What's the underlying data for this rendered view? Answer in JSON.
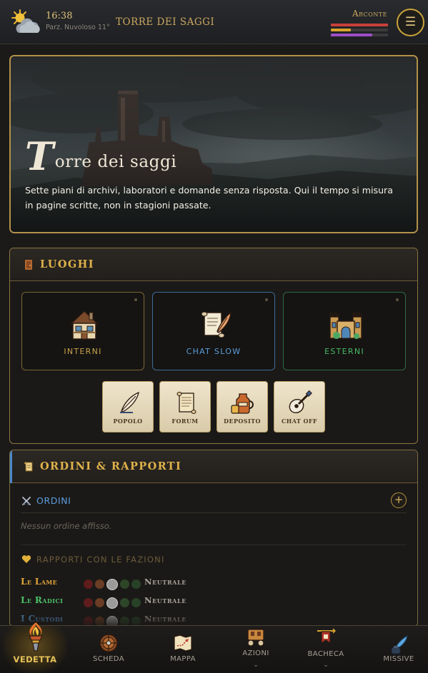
{
  "topbar": {
    "time": "16:38",
    "weather": "Parz. Nuvoloso 11°",
    "weather_icon": "sun-cloud-icon",
    "location": "TORRE DEI SAGGI",
    "role": "Arconte",
    "stats": [
      {
        "name": "health",
        "color": "#c8403a",
        "fraction": 1.0
      },
      {
        "name": "energy",
        "color": "#d9a32a",
        "fraction": 0.35
      },
      {
        "name": "mana",
        "color": "#9d4ec7",
        "fraction": 0.72
      }
    ],
    "menu_glyph": "☰"
  },
  "hero": {
    "initial": "T",
    "title_rest": "orre dei saggi",
    "description": "Sette piani di archivi, laboratori e domande senza risposta. Qui il tempo si misura in pagine scritte, non in stagioni passate."
  },
  "luoghi": {
    "title": "LUOGHI",
    "cards": [
      {
        "label": "INTERNI",
        "icon": "house-icon",
        "color": "#c9a24b"
      },
      {
        "label": "CHAT SLOW",
        "icon": "scroll-quill-icon",
        "color": "#5b9ddd"
      },
      {
        "label": "ESTERNI",
        "icon": "castle-icon",
        "color": "#49b96a"
      }
    ],
    "tiles": [
      {
        "label": "POPOLO",
        "icon": "quill-icon"
      },
      {
        "label": "FORUM",
        "icon": "parchment-icon"
      },
      {
        "label": "DEPOSITO",
        "icon": "jug-icon"
      },
      {
        "label": "CHAT OFF",
        "icon": "lute-icon"
      }
    ]
  },
  "ordini": {
    "title": "ORDINI & RAPPORTI",
    "orders_label": "ORDINI",
    "add_glyph": "+",
    "empty_note": "Nessun ordine affisso.",
    "relations_label": "RAPPORTI CON LE FAZIONI",
    "factions": [
      {
        "name": "Le Lame",
        "color": "#e0a63a",
        "status": "Neutrale"
      },
      {
        "name": "Le Radici",
        "color": "#4cc06a",
        "status": "Neutrale"
      },
      {
        "name": "I Custodi",
        "color": "#5b9ddd",
        "status": "Neutrale"
      }
    ],
    "relation_colors": [
      "#5e1c1c",
      "#6a3d24",
      "sel",
      "#2e4628",
      "#274227"
    ]
  },
  "nav": [
    {
      "label": "VEDETTA",
      "icon": "torch-icon",
      "active": true
    },
    {
      "label": "SCHEDA",
      "icon": "shield-icon"
    },
    {
      "label": "MAPPA",
      "icon": "map-icon"
    },
    {
      "label": "AZIONI",
      "icon": "wagon-icon",
      "chevron": "⌄"
    },
    {
      "label": "BACHECA",
      "icon": "banner-icon",
      "chevron": "⌄"
    },
    {
      "label": "MISSIVE",
      "icon": "inkwell-icon"
    }
  ]
}
